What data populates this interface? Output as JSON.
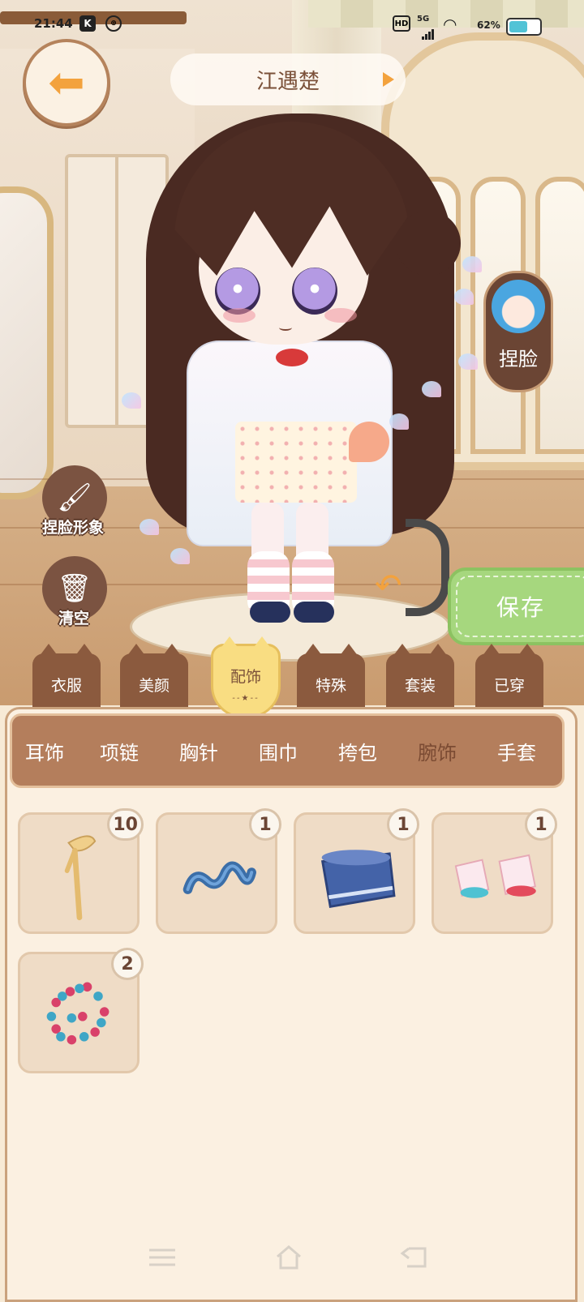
{
  "status_bar": {
    "time": "21:44",
    "network": "5G",
    "hd_label": "HD",
    "battery_percent": "62%",
    "battery_level": 0.62
  },
  "header": {
    "character_name": "江遇楚",
    "back_icon": "back-arrow-icon"
  },
  "side_buttons": {
    "pinch_face": "捏脸",
    "pinch_face_image": "捏脸形象",
    "clear": "清空",
    "save": "保存"
  },
  "categories": [
    {
      "label": "衣服",
      "active": false
    },
    {
      "label": "美颜",
      "active": false
    },
    {
      "label": "配饰",
      "active": true
    },
    {
      "label": "特殊",
      "active": false
    },
    {
      "label": "套装",
      "active": false
    },
    {
      "label": "已穿",
      "active": false
    }
  ],
  "subcategories": [
    {
      "label": "耳饰",
      "active": false
    },
    {
      "label": "项链",
      "active": false
    },
    {
      "label": "胸针",
      "active": false
    },
    {
      "label": "围巾",
      "active": false
    },
    {
      "label": "挎包",
      "active": false
    },
    {
      "label": "腕饰",
      "active": true
    },
    {
      "label": "手套",
      "active": false
    }
  ],
  "items": [
    {
      "icon": "ribbon-bracelet-icon",
      "count": "10"
    },
    {
      "icon": "blue-wave-bracelet-icon",
      "count": "1"
    },
    {
      "icon": "blue-cuff-icon",
      "count": "1"
    },
    {
      "icon": "pink-cuffs-icon",
      "count": "1"
    },
    {
      "icon": "bead-bracelet-icon",
      "count": "2"
    }
  ],
  "colors": {
    "accent": "#f3a23d",
    "tab_brown": "#8b5a3e",
    "active_tab": "#f9dd82",
    "save_green": "#a6d77e",
    "panel_bg": "#fbf0e1"
  }
}
